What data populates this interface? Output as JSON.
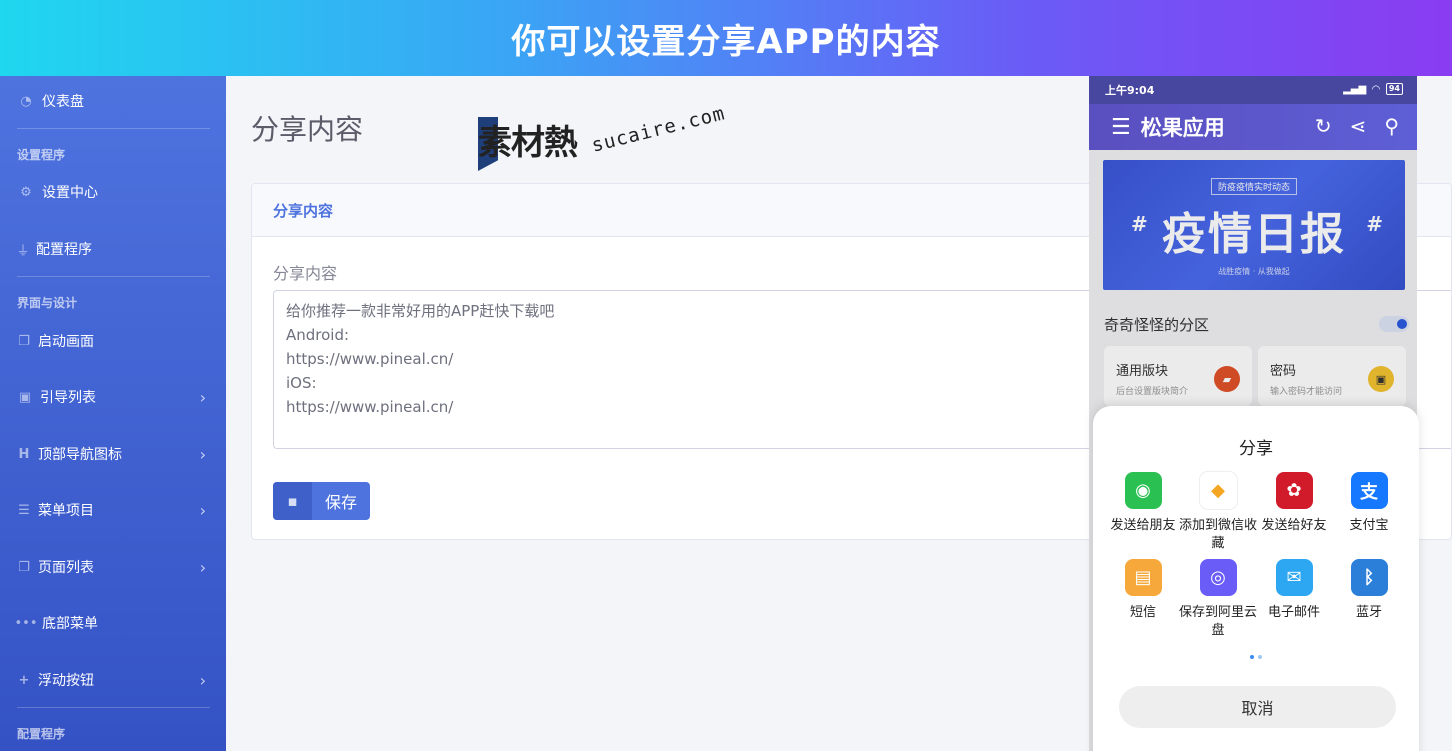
{
  "banner": {
    "title": "你可以设置分享APP的内容"
  },
  "sidebar": {
    "items": [
      {
        "label": "仪表盘",
        "icon": "dashboard-icon"
      },
      {
        "label": "设置中心",
        "icon": "cogs-icon"
      },
      {
        "label": "配置程序",
        "icon": "plug-icon"
      },
      {
        "label": "启动画面",
        "icon": "copy-icon"
      },
      {
        "label": "引导列表",
        "icon": "images-icon"
      },
      {
        "label": "顶部导航图标",
        "icon": "heading-icon"
      },
      {
        "label": "菜单项目",
        "icon": "list-icon"
      },
      {
        "label": "页面列表",
        "icon": "copy-icon"
      },
      {
        "label": "底部菜单",
        "icon": "ellipsis-icon"
      },
      {
        "label": "浮动按钮",
        "icon": "plus-icon"
      }
    ],
    "headings": [
      "设置程序",
      "界面与设计",
      "配置程序"
    ]
  },
  "main": {
    "page_title": "分享内容",
    "card_title": "分享内容",
    "field_label": "分享内容",
    "share_text": "给你推荐一款非常好用的APP赶快下载吧\nAndroid:\nhttps://www.pineal.cn/\niOS:\nhttps://www.pineal.cn/",
    "save_label": "保存"
  },
  "watermark": {
    "logo": "素材熱",
    "url": "sucaire.com"
  },
  "phone": {
    "status_time": "上午9:04",
    "battery": "94",
    "app_title": "松果应用",
    "banner_tag": "防疫疫情实时动态",
    "banner_big": "疫情日报",
    "banner_hash": "#",
    "banner_sub": "战胜疫情 · 从我做起",
    "section_title": "奇奇怪怪的分区",
    "tiles": [
      {
        "title": "通用版块",
        "desc": "后台设置版块简介"
      },
      {
        "title": "密码",
        "desc": "输入密码才能访问"
      }
    ]
  },
  "share_sheet": {
    "title": "分享",
    "items": [
      {
        "label": "发送给朋友",
        "color": "#2ac052",
        "icon": "wechat-icon",
        "glyph": "◉"
      },
      {
        "label": "添加到微信收藏",
        "color": "#ffffff",
        "icon": "cube-icon",
        "glyph": "◆"
      },
      {
        "label": "发送给好友",
        "color": "#d11a2a",
        "icon": "huawei-icon",
        "glyph": "✿"
      },
      {
        "label": "支付宝",
        "color": "#1677ff",
        "icon": "alipay-icon",
        "glyph": "支"
      },
      {
        "label": "短信",
        "color": "#f7a83b",
        "icon": "message-icon",
        "glyph": "▤"
      },
      {
        "label": "保存到阿里云盘",
        "color": "#6a5cf6",
        "icon": "cloud-icon",
        "glyph": "◎"
      },
      {
        "label": "电子邮件",
        "color": "#2ea7f2",
        "icon": "mail-icon",
        "glyph": "✉"
      },
      {
        "label": "蓝牙",
        "color": "#2b7fd8",
        "icon": "bluetooth-icon",
        "glyph": "ᛒ"
      }
    ],
    "cancel_label": "取消"
  }
}
